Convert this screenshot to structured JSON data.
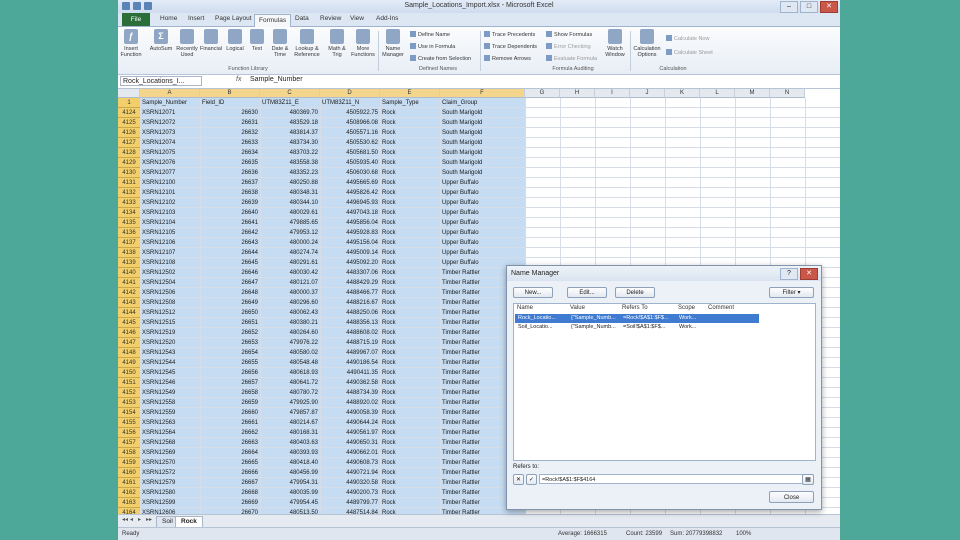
{
  "window": {
    "title": "Sample_Locations_Import.xlsx - Microsoft Excel",
    "controls": [
      "–",
      "□",
      "✕"
    ]
  },
  "ribbon_tabs": [
    "File",
    "Home",
    "Insert",
    "Page Layout",
    "Formulas",
    "Data",
    "Review",
    "View",
    "Add-Ins"
  ],
  "ribbon": {
    "function_library": {
      "buttons": [
        "Insert Function",
        "AutoSum",
        "Recently Used",
        "Financial",
        "Logical",
        "Text",
        "Date & Time",
        "Lookup & Reference",
        "Math & Trig",
        "More Functions"
      ],
      "label": "Function Library"
    },
    "defined_names": {
      "name_manager": "Name Manager",
      "items": [
        "Define Name",
        "Use in Formula",
        "Create from Selection"
      ],
      "label": "Defined Names"
    },
    "formula_auditing": {
      "items": [
        "Trace Precedents",
        "Trace Dependents",
        "Remove Arrows",
        "Show Formulas",
        "Error Checking",
        "Evaluate Formula"
      ],
      "watch_window": "Watch Window",
      "label": "Formula Auditing"
    },
    "calculation": {
      "options": "Calculation Options",
      "items": [
        "Calculate Now",
        "Calculate Sheet"
      ],
      "label": "Calculation"
    }
  },
  "formula_bar": {
    "name_box": "Rock_Locations_I...",
    "fx": "fx",
    "value": "Sample_Number"
  },
  "grid": {
    "columns": [
      "A",
      "B",
      "C",
      "D",
      "E",
      "F",
      "G",
      "H",
      "I",
      "J",
      "K",
      "L",
      "M",
      "N"
    ],
    "header_row": {
      "num": "1",
      "cells": [
        "Sample_Number",
        "Field_ID",
        "UTM83Z11_E",
        "UTM83Z11_N",
        "Sample_Type",
        "Claim_Group"
      ]
    },
    "rows": [
      {
        "num": "4124",
        "cells": [
          "XSRN12071",
          "26630",
          "480369.70",
          "4505922.75",
          "Rock",
          "South Marigold"
        ]
      },
      {
        "num": "4125",
        "cells": [
          "XSRN12072",
          "26631",
          "483529.18",
          "4508966.08",
          "Rock",
          "South Marigold"
        ]
      },
      {
        "num": "4126",
        "cells": [
          "XSRN12073",
          "26632",
          "483814.37",
          "4505571.16",
          "Rock",
          "South Marigold"
        ]
      },
      {
        "num": "4127",
        "cells": [
          "XSRN12074",
          "26633",
          "483734.30",
          "4505530.62",
          "Rock",
          "South Marigold"
        ]
      },
      {
        "num": "4128",
        "cells": [
          "XSRN12075",
          "26634",
          "483703.22",
          "4505681.50",
          "Rock",
          "South Marigold"
        ]
      },
      {
        "num": "4129",
        "cells": [
          "XSRN12076",
          "26635",
          "483558.38",
          "4505935.40",
          "Rock",
          "South Marigold"
        ]
      },
      {
        "num": "4130",
        "cells": [
          "XSRN12077",
          "26636",
          "483352.23",
          "4506030.68",
          "Rock",
          "South Marigold"
        ]
      },
      {
        "num": "4131",
        "cells": [
          "XSRN12100",
          "26637",
          "480250.88",
          "4495665.69",
          "Rock",
          "Upper Buffalo"
        ]
      },
      {
        "num": "4132",
        "cells": [
          "XSRN12101",
          "26638",
          "480348.31",
          "4495826.42",
          "Rock",
          "Upper Buffalo"
        ]
      },
      {
        "num": "4133",
        "cells": [
          "XSRN12102",
          "26639",
          "480344.10",
          "4496945.93",
          "Rock",
          "Upper Buffalo"
        ]
      },
      {
        "num": "4134",
        "cells": [
          "XSRN12103",
          "26640",
          "480029.61",
          "4497043.18",
          "Rock",
          "Upper Buffalo"
        ]
      },
      {
        "num": "4135",
        "cells": [
          "XSRN12104",
          "26641",
          "479885.65",
          "4495856.04",
          "Rock",
          "Upper Buffalo"
        ]
      },
      {
        "num": "4136",
        "cells": [
          "XSRN12105",
          "26642",
          "479953.12",
          "4495928.83",
          "Rock",
          "Upper Buffalo"
        ]
      },
      {
        "num": "4137",
        "cells": [
          "XSRN12106",
          "26643",
          "480000.24",
          "4495156.04",
          "Rock",
          "Upper Buffalo"
        ]
      },
      {
        "num": "4138",
        "cells": [
          "XSRN12107",
          "26644",
          "480274.74",
          "4495009.14",
          "Rock",
          "Upper Buffalo"
        ]
      },
      {
        "num": "4139",
        "cells": [
          "XSRN12108",
          "26645",
          "480291.61",
          "4495092.20",
          "Rock",
          "Upper Buffalo"
        ]
      },
      {
        "num": "4140",
        "cells": [
          "XSRN12502",
          "26646",
          "480030.42",
          "4483307.06",
          "Rock",
          "Timber Rattler"
        ]
      },
      {
        "num": "4141",
        "cells": [
          "XSRN12504",
          "26647",
          "480121.07",
          "4488429.29",
          "Rock",
          "Timber Rattler"
        ]
      },
      {
        "num": "4142",
        "cells": [
          "XSRN12506",
          "26648",
          "480000.37",
          "4488466.77",
          "Rock",
          "Timber Rattler"
        ]
      },
      {
        "num": "4143",
        "cells": [
          "XSRN12508",
          "26649",
          "480296.60",
          "4488216.67",
          "Rock",
          "Timber Rattler"
        ]
      },
      {
        "num": "4144",
        "cells": [
          "XSRN12512",
          "26650",
          "480062.43",
          "4488250.06",
          "Rock",
          "Timber Rattler"
        ]
      },
      {
        "num": "4145",
        "cells": [
          "XSRN12515",
          "26651",
          "480380.21",
          "4488356.13",
          "Rock",
          "Timber Rattler"
        ]
      },
      {
        "num": "4146",
        "cells": [
          "XSRN12519",
          "26652",
          "480264.60",
          "4488608.02",
          "Rock",
          "Timber Rattler"
        ]
      },
      {
        "num": "4147",
        "cells": [
          "XSRN12520",
          "26653",
          "479976.22",
          "4488715.19",
          "Rock",
          "Timber Rattler"
        ]
      },
      {
        "num": "4148",
        "cells": [
          "XSRN12543",
          "26654",
          "480580.02",
          "4489967.07",
          "Rock",
          "Timber Rattler"
        ]
      },
      {
        "num": "4149",
        "cells": [
          "XSRN12544",
          "26655",
          "480548.48",
          "4490186.54",
          "Rock",
          "Timber Rattler"
        ]
      },
      {
        "num": "4150",
        "cells": [
          "XSRN12545",
          "26656",
          "480618.93",
          "4490411.35",
          "Rock",
          "Timber Rattler"
        ]
      },
      {
        "num": "4151",
        "cells": [
          "XSRN12546",
          "26657",
          "480641.72",
          "4490362.58",
          "Rock",
          "Timber Rattler"
        ]
      },
      {
        "num": "4152",
        "cells": [
          "XSRN12549",
          "26658",
          "480780.72",
          "4488734.39",
          "Rock",
          "Timber Rattler"
        ]
      },
      {
        "num": "4153",
        "cells": [
          "XSRN12558",
          "26659",
          "479925.90",
          "4488920.02",
          "Rock",
          "Timber Rattler"
        ]
      },
      {
        "num": "4154",
        "cells": [
          "XSRN12559",
          "26660",
          "479857.87",
          "4490058.39",
          "Rock",
          "Timber Rattler"
        ]
      },
      {
        "num": "4155",
        "cells": [
          "XSRN12563",
          "26661",
          "480214.67",
          "4490644.24",
          "Rock",
          "Timber Rattler"
        ]
      },
      {
        "num": "4156",
        "cells": [
          "XSRN12564",
          "26662",
          "480168.31",
          "4490561.97",
          "Rock",
          "Timber Rattler"
        ]
      },
      {
        "num": "4157",
        "cells": [
          "XSRN12568",
          "26663",
          "480403.63",
          "4490650.31",
          "Rock",
          "Timber Rattler"
        ]
      },
      {
        "num": "4158",
        "cells": [
          "XSRN12569",
          "26664",
          "480393.93",
          "4490662.01",
          "Rock",
          "Timber Rattler"
        ]
      },
      {
        "num": "4159",
        "cells": [
          "XSRN12570",
          "26665",
          "480418.40",
          "4490608.73",
          "Rock",
          "Timber Rattler"
        ]
      },
      {
        "num": "4160",
        "cells": [
          "XSRN12572",
          "26666",
          "480456.99",
          "4490721.94",
          "Rock",
          "Timber Rattler"
        ]
      },
      {
        "num": "4161",
        "cells": [
          "XSRN12579",
          "26667",
          "479954.31",
          "4490320.58",
          "Rock",
          "Timber Rattler"
        ]
      },
      {
        "num": "4162",
        "cells": [
          "XSRN12580",
          "26668",
          "480035.99",
          "4490200.73",
          "Rock",
          "Timber Rattler"
        ]
      },
      {
        "num": "4163",
        "cells": [
          "XSRN12599",
          "26669",
          "479954.45",
          "4489799.77",
          "Rock",
          "Timber Rattler"
        ]
      },
      {
        "num": "4164",
        "cells": [
          "XSRN12606",
          "26670",
          "480513.50",
          "4487514.84",
          "Rock",
          "Timber Rattler"
        ]
      }
    ]
  },
  "sheet_tabs": {
    "nav": [
      "◂◂",
      "◂",
      "▸",
      "▸▸"
    ],
    "tabs": [
      "Soil",
      "Rock"
    ],
    "active": "Rock"
  },
  "status_bar": {
    "ready": "Ready",
    "average": "Average: 1666315",
    "count": "Count: 23599",
    "sum": "Sum: 20779398832",
    "zoom": "100%"
  },
  "name_manager": {
    "title": "Name Manager",
    "buttons": {
      "new": "New...",
      "edit": "Edit...",
      "delete": "Delete",
      "filter": "Filter ▾",
      "close": "Close"
    },
    "columns": [
      "Name",
      "Value",
      "Refers To",
      "Scope",
      "Comment"
    ],
    "rows": [
      {
        "name": "Rock_Locatio...",
        "value": "{\"Sample_Numb...",
        "refers_to": "=Rock!$A$1:$F$...",
        "scope": "Work...",
        "comment": ""
      },
      {
        "name": "Soil_Locatio...",
        "value": "{\"Sample_Numb...",
        "refers_to": "=Soil!$A$1:$F$...",
        "scope": "Work...",
        "comment": ""
      }
    ],
    "refers_to_label": "Refers to:",
    "refers_to_value": "=Rock!$A$1:$F$4164"
  }
}
